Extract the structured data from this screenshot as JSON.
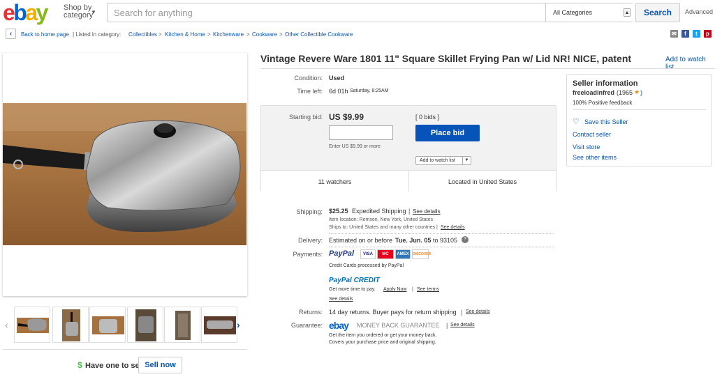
{
  "header": {
    "logo_letters": [
      "e",
      "b",
      "a",
      "y"
    ],
    "logo_colors": [
      "#e53238",
      "#0064d2",
      "#f5af02",
      "#86b817"
    ],
    "shop_by": "Shop by",
    "category": "category",
    "search_placeholder": "Search for anything",
    "category_select": "All Categories",
    "search_button": "Search",
    "advanced": "Advanced"
  },
  "breadcrumb": {
    "back": "Back to home page",
    "listed_in": "| Listed in category:",
    "items": [
      "Collectibles",
      "Kitchen & Home",
      "Kitchenware",
      "Cookware",
      "Other Collectible Cookware"
    ]
  },
  "listing": {
    "title": "Vintage Revere Ware 1801 11\" Square Skillet Frying Pan w/ Lid NR! NICE, patent",
    "add_to_watch": "Add to watch list",
    "condition_label": "Condition:",
    "condition": "Used",
    "time_left_label": "Time left:",
    "time_left": "6d 01h",
    "time_left_detail": "Saturday, 8:25AM",
    "starting_bid_label": "Starting bid:",
    "starting_bid": "US $9.99",
    "bids": "[ 0 bids ]",
    "bid_hint": "Enter US $9.99 or more",
    "place_bid": "Place bid",
    "add_watch_small": "Add to watch list",
    "watchers": "11 watchers",
    "location": "Located in United States"
  },
  "shipping": {
    "label": "Shipping:",
    "cost": "$25.25",
    "method": "Expedited Shipping",
    "see_details": "See details",
    "item_location": "Item location:  Remsen, New York, United States",
    "ships_to": "Ships to:  United States and many other countries",
    "see_details2": "See details"
  },
  "delivery": {
    "label": "Delivery:",
    "prefix": "Estimated on or before",
    "date": "Tue. Jun. 05",
    "suffix": "to 93105"
  },
  "payments": {
    "label": "Payments:",
    "paypal": "PayPal",
    "cards": [
      "VISA",
      "MC",
      "AMEX",
      "DISCOVER"
    ],
    "card_colors": [
      "#1a1f71",
      "#eb001b",
      "#2e77bb",
      "#f58220"
    ],
    "processed": "Credit Cards processed by PayPal",
    "paypal_credit": "PayPal CREDIT",
    "more_time": "Get more time to pay.",
    "apply_now": "Apply Now",
    "see_terms": "See terms",
    "see_details": "See details"
  },
  "returns": {
    "label": "Returns:",
    "text": "14 day returns. Buyer pays for return shipping",
    "see_details": "See details"
  },
  "guarantee": {
    "label": "Guarantee:",
    "brand": "ebay",
    "text": "MONEY BACK GUARANTEE",
    "see_details": "See details",
    "line1": "Get the item you ordered or get your money back.",
    "line2": "Covers your purchase price and original shipping."
  },
  "seller": {
    "heading": "Seller information",
    "name": "freeloadinfred",
    "score": "(1965",
    "score_close": ")",
    "feedback": "100% Positive feedback",
    "save": "Save this Seller",
    "contact": "Contact seller",
    "visit": "Visit store",
    "other": "See other items"
  },
  "sell": {
    "have_one": "Have one to sell?",
    "sell_now": "Sell now"
  }
}
